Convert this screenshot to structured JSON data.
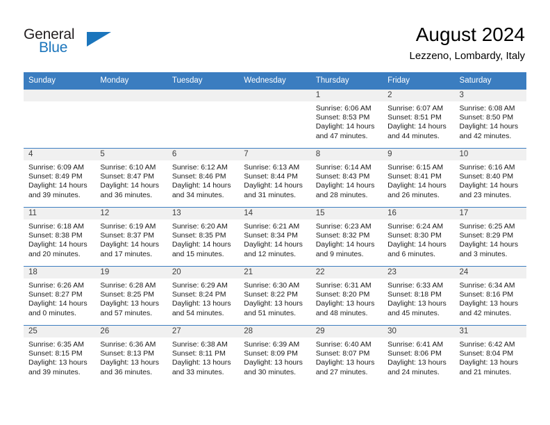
{
  "brand": {
    "name_top": "General",
    "name_bottom": "Blue",
    "triangle_icon": "triangle-icon",
    "color_black": "#231f20",
    "color_blue": "#1b75bc"
  },
  "header": {
    "month_title": "August 2024",
    "location": "Lezzeno, Lombardy, Italy",
    "accent_color": "#3b7dc0",
    "band_color": "#f0f0f0"
  },
  "calendar": {
    "weekday_headers": [
      "Sunday",
      "Monday",
      "Tuesday",
      "Wednesday",
      "Thursday",
      "Friday",
      "Saturday"
    ],
    "weeks": [
      [
        {
          "day": "",
          "empty": true,
          "sunrise": "",
          "sunset": "",
          "daylight1": "",
          "daylight2": ""
        },
        {
          "day": "",
          "empty": true,
          "sunrise": "",
          "sunset": "",
          "daylight1": "",
          "daylight2": ""
        },
        {
          "day": "",
          "empty": true,
          "sunrise": "",
          "sunset": "",
          "daylight1": "",
          "daylight2": ""
        },
        {
          "day": "",
          "empty": true,
          "sunrise": "",
          "sunset": "",
          "daylight1": "",
          "daylight2": ""
        },
        {
          "day": "1",
          "empty": false,
          "sunrise": "Sunrise: 6:06 AM",
          "sunset": "Sunset: 8:53 PM",
          "daylight1": "Daylight: 14 hours",
          "daylight2": "and 47 minutes."
        },
        {
          "day": "2",
          "empty": false,
          "sunrise": "Sunrise: 6:07 AM",
          "sunset": "Sunset: 8:51 PM",
          "daylight1": "Daylight: 14 hours",
          "daylight2": "and 44 minutes."
        },
        {
          "day": "3",
          "empty": false,
          "sunrise": "Sunrise: 6:08 AM",
          "sunset": "Sunset: 8:50 PM",
          "daylight1": "Daylight: 14 hours",
          "daylight2": "and 42 minutes."
        }
      ],
      [
        {
          "day": "4",
          "empty": false,
          "sunrise": "Sunrise: 6:09 AM",
          "sunset": "Sunset: 8:49 PM",
          "daylight1": "Daylight: 14 hours",
          "daylight2": "and 39 minutes."
        },
        {
          "day": "5",
          "empty": false,
          "sunrise": "Sunrise: 6:10 AM",
          "sunset": "Sunset: 8:47 PM",
          "daylight1": "Daylight: 14 hours",
          "daylight2": "and 36 minutes."
        },
        {
          "day": "6",
          "empty": false,
          "sunrise": "Sunrise: 6:12 AM",
          "sunset": "Sunset: 8:46 PM",
          "daylight1": "Daylight: 14 hours",
          "daylight2": "and 34 minutes."
        },
        {
          "day": "7",
          "empty": false,
          "sunrise": "Sunrise: 6:13 AM",
          "sunset": "Sunset: 8:44 PM",
          "daylight1": "Daylight: 14 hours",
          "daylight2": "and 31 minutes."
        },
        {
          "day": "8",
          "empty": false,
          "sunrise": "Sunrise: 6:14 AM",
          "sunset": "Sunset: 8:43 PM",
          "daylight1": "Daylight: 14 hours",
          "daylight2": "and 28 minutes."
        },
        {
          "day": "9",
          "empty": false,
          "sunrise": "Sunrise: 6:15 AM",
          "sunset": "Sunset: 8:41 PM",
          "daylight1": "Daylight: 14 hours",
          "daylight2": "and 26 minutes."
        },
        {
          "day": "10",
          "empty": false,
          "sunrise": "Sunrise: 6:16 AM",
          "sunset": "Sunset: 8:40 PM",
          "daylight1": "Daylight: 14 hours",
          "daylight2": "and 23 minutes."
        }
      ],
      [
        {
          "day": "11",
          "empty": false,
          "sunrise": "Sunrise: 6:18 AM",
          "sunset": "Sunset: 8:38 PM",
          "daylight1": "Daylight: 14 hours",
          "daylight2": "and 20 minutes."
        },
        {
          "day": "12",
          "empty": false,
          "sunrise": "Sunrise: 6:19 AM",
          "sunset": "Sunset: 8:37 PM",
          "daylight1": "Daylight: 14 hours",
          "daylight2": "and 17 minutes."
        },
        {
          "day": "13",
          "empty": false,
          "sunrise": "Sunrise: 6:20 AM",
          "sunset": "Sunset: 8:35 PM",
          "daylight1": "Daylight: 14 hours",
          "daylight2": "and 15 minutes."
        },
        {
          "day": "14",
          "empty": false,
          "sunrise": "Sunrise: 6:21 AM",
          "sunset": "Sunset: 8:34 PM",
          "daylight1": "Daylight: 14 hours",
          "daylight2": "and 12 minutes."
        },
        {
          "day": "15",
          "empty": false,
          "sunrise": "Sunrise: 6:23 AM",
          "sunset": "Sunset: 8:32 PM",
          "daylight1": "Daylight: 14 hours",
          "daylight2": "and 9 minutes."
        },
        {
          "day": "16",
          "empty": false,
          "sunrise": "Sunrise: 6:24 AM",
          "sunset": "Sunset: 8:30 PM",
          "daylight1": "Daylight: 14 hours",
          "daylight2": "and 6 minutes."
        },
        {
          "day": "17",
          "empty": false,
          "sunrise": "Sunrise: 6:25 AM",
          "sunset": "Sunset: 8:29 PM",
          "daylight1": "Daylight: 14 hours",
          "daylight2": "and 3 minutes."
        }
      ],
      [
        {
          "day": "18",
          "empty": false,
          "sunrise": "Sunrise: 6:26 AM",
          "sunset": "Sunset: 8:27 PM",
          "daylight1": "Daylight: 14 hours",
          "daylight2": "and 0 minutes."
        },
        {
          "day": "19",
          "empty": false,
          "sunrise": "Sunrise: 6:28 AM",
          "sunset": "Sunset: 8:25 PM",
          "daylight1": "Daylight: 13 hours",
          "daylight2": "and 57 minutes."
        },
        {
          "day": "20",
          "empty": false,
          "sunrise": "Sunrise: 6:29 AM",
          "sunset": "Sunset: 8:24 PM",
          "daylight1": "Daylight: 13 hours",
          "daylight2": "and 54 minutes."
        },
        {
          "day": "21",
          "empty": false,
          "sunrise": "Sunrise: 6:30 AM",
          "sunset": "Sunset: 8:22 PM",
          "daylight1": "Daylight: 13 hours",
          "daylight2": "and 51 minutes."
        },
        {
          "day": "22",
          "empty": false,
          "sunrise": "Sunrise: 6:31 AM",
          "sunset": "Sunset: 8:20 PM",
          "daylight1": "Daylight: 13 hours",
          "daylight2": "and 48 minutes."
        },
        {
          "day": "23",
          "empty": false,
          "sunrise": "Sunrise: 6:33 AM",
          "sunset": "Sunset: 8:18 PM",
          "daylight1": "Daylight: 13 hours",
          "daylight2": "and 45 minutes."
        },
        {
          "day": "24",
          "empty": false,
          "sunrise": "Sunrise: 6:34 AM",
          "sunset": "Sunset: 8:16 PM",
          "daylight1": "Daylight: 13 hours",
          "daylight2": "and 42 minutes."
        }
      ],
      [
        {
          "day": "25",
          "empty": false,
          "sunrise": "Sunrise: 6:35 AM",
          "sunset": "Sunset: 8:15 PM",
          "daylight1": "Daylight: 13 hours",
          "daylight2": "and 39 minutes."
        },
        {
          "day": "26",
          "empty": false,
          "sunrise": "Sunrise: 6:36 AM",
          "sunset": "Sunset: 8:13 PM",
          "daylight1": "Daylight: 13 hours",
          "daylight2": "and 36 minutes."
        },
        {
          "day": "27",
          "empty": false,
          "sunrise": "Sunrise: 6:38 AM",
          "sunset": "Sunset: 8:11 PM",
          "daylight1": "Daylight: 13 hours",
          "daylight2": "and 33 minutes."
        },
        {
          "day": "28",
          "empty": false,
          "sunrise": "Sunrise: 6:39 AM",
          "sunset": "Sunset: 8:09 PM",
          "daylight1": "Daylight: 13 hours",
          "daylight2": "and 30 minutes."
        },
        {
          "day": "29",
          "empty": false,
          "sunrise": "Sunrise: 6:40 AM",
          "sunset": "Sunset: 8:07 PM",
          "daylight1": "Daylight: 13 hours",
          "daylight2": "and 27 minutes."
        },
        {
          "day": "30",
          "empty": false,
          "sunrise": "Sunrise: 6:41 AM",
          "sunset": "Sunset: 8:06 PM",
          "daylight1": "Daylight: 13 hours",
          "daylight2": "and 24 minutes."
        },
        {
          "day": "31",
          "empty": false,
          "sunrise": "Sunrise: 6:42 AM",
          "sunset": "Sunset: 8:04 PM",
          "daylight1": "Daylight: 13 hours",
          "daylight2": "and 21 minutes."
        }
      ]
    ]
  }
}
